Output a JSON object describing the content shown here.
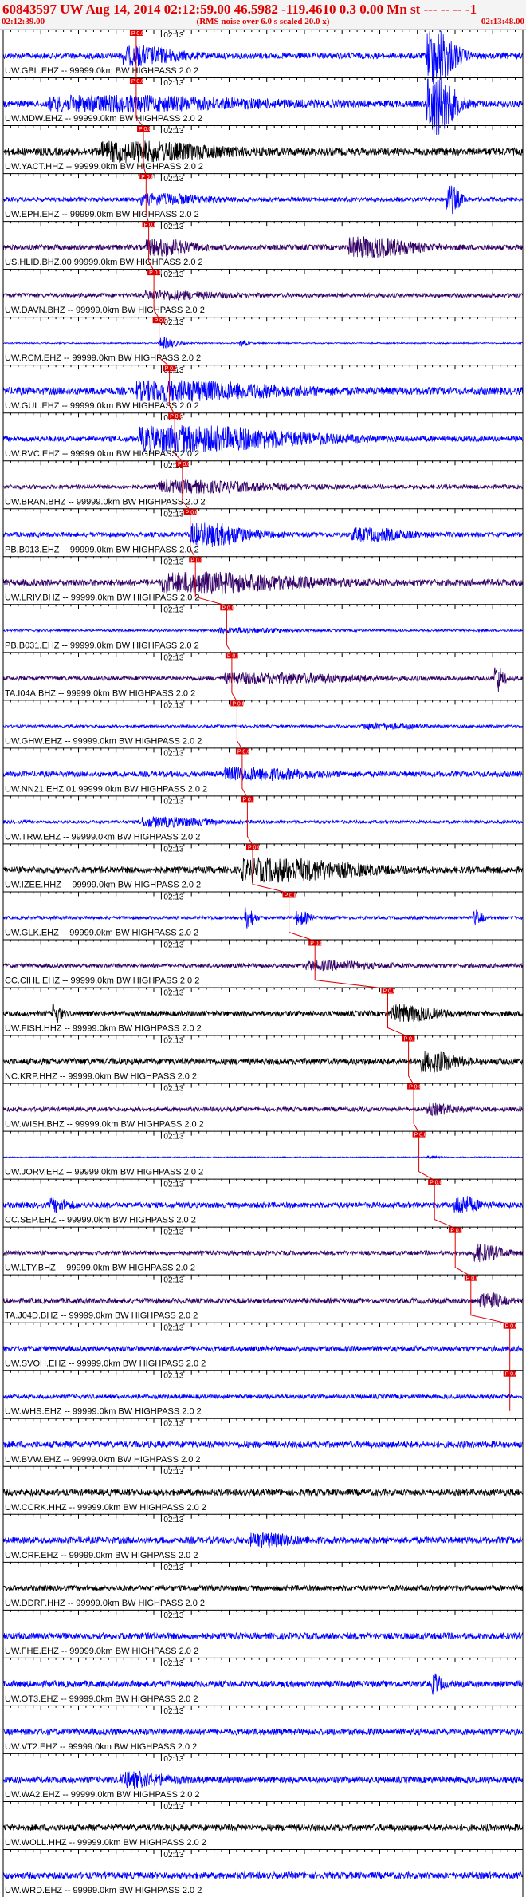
{
  "header": {
    "title": "60843597 UW Aug 14, 2014 02:12:59.00   46.5982 -119.4610  0.3 0.00 Mn st --- -- --  -1",
    "start_time": "02:12:39.00",
    "note": "(RMS noise over 6.0 s scaled 20.0 x)",
    "end_time": "02:13:48.00"
  },
  "minute_label": "02:13",
  "pick_marker_text": "P 0.0",
  "colors": {
    "title": "#e00000",
    "pick": "#e00000",
    "axis": "#000000"
  },
  "traces": [
    {
      "label": "UW.GBL.EHZ -- 99999.0km BW  HIGHPASS  2.0  2",
      "color": "#0000ff",
      "amp": 0.28,
      "pick": 0.256,
      "events": [
        [
          0.26,
          0.12,
          2.5
        ],
        [
          0.83,
          0.06,
          9
        ]
      ]
    },
    {
      "label": "UW.MDW.EHZ -- 99999.0km BW  HIGHPASS  2.0  2",
      "color": "#0000ff",
      "amp": 0.3,
      "pick": 0.256,
      "events": [
        [
          0.2,
          0.45,
          1.8
        ],
        [
          0.83,
          0.06,
          9
        ]
      ]
    },
    {
      "label": "UW.YACT.HHZ -- 99999.0km BW  HIGHPASS  2.0  2",
      "color": "#000000",
      "amp": 0.35,
      "pick": 0.27,
      "events": [
        [
          0.25,
          0.25,
          2.0
        ]
      ]
    },
    {
      "label": "UW.EPH.EHZ -- 99999.0km BW  HIGHPASS  2.0  2",
      "color": "#0000ff",
      "amp": 0.2,
      "pick": 0.275,
      "events": [
        [
          0.3,
          0.14,
          2.0
        ],
        [
          0.86,
          0.03,
          6
        ]
      ]
    },
    {
      "label": "US.HLID.BHZ.00 99999.0km BW  HIGHPASS  2.0  2",
      "color": "#330066",
      "amp": 0.25,
      "pick": 0.28,
      "events": [
        [
          0.3,
          0.1,
          2.5
        ],
        [
          0.7,
          0.14,
          3.2
        ]
      ]
    },
    {
      "label": "UW.DAVN.BHZ -- 99999.0km BW  HIGHPASS  2.0  2",
      "color": "#330066",
      "amp": 0.2,
      "pick": 0.29,
      "events": [
        [
          0.31,
          0.15,
          1.5
        ]
      ]
    },
    {
      "label": "UW.RCM.EHZ -- 99999.0km BW  HIGHPASS  2.0  2",
      "color": "#0000ff",
      "amp": 0.06,
      "pick": 0.3,
      "events": [
        [
          0.31,
          0.04,
          8
        ],
        [
          0.46,
          0.02,
          4
        ]
      ]
    },
    {
      "label": "UW.GUL.EHZ -- 99999.0km BW  HIGHPASS  2.0  2",
      "color": "#0000ff",
      "amp": 0.35,
      "pick": 0.32,
      "events": [
        [
          0.33,
          0.3,
          2.0
        ]
      ]
    },
    {
      "label": "UW.RVC.EHZ -- 99999.0km BW  HIGHPASS  2.0  2",
      "color": "#0000ff",
      "amp": 0.25,
      "pick": 0.33,
      "events": [
        [
          0.35,
          0.35,
          4.2
        ]
      ]
    },
    {
      "label": "UW.BRAN.BHZ -- 99999.0km BW  HIGHPASS  2.0  2",
      "color": "#330066",
      "amp": 0.2,
      "pick": 0.345,
      "events": [
        [
          0.36,
          0.25,
          2.2
        ]
      ]
    },
    {
      "label": "PB.B013.EHZ -- 99999.0km BW  HIGHPASS  2.0  2",
      "color": "#0000ff",
      "amp": 0.22,
      "pick": 0.36,
      "events": [
        [
          0.39,
          0.12,
          4.5
        ],
        [
          0.7,
          0.12,
          2.2
        ]
      ]
    },
    {
      "label": "UW.LRIV.BHZ -- 99999.0km BW  HIGHPASS  2.0  2",
      "color": "#330066",
      "amp": 0.3,
      "pick": 0.37,
      "events": [
        [
          0.38,
          0.3,
          2.5
        ]
      ]
    },
    {
      "label": "PB.B031.EHZ -- 99999.0km BW  HIGHPASS  2.0  2",
      "color": "#0000ff",
      "amp": 0.1,
      "pick": 0.43,
      "events": [
        [
          0.45,
          0.15,
          2.0
        ]
      ]
    },
    {
      "label": "TA.I04A.BHZ -- 99999.0km BW  HIGHPASS  2.0  2",
      "color": "#330066",
      "amp": 0.2,
      "pick": 0.44,
      "events": [
        [
          0.5,
          0.3,
          1.8
        ],
        [
          0.95,
          0.02,
          6
        ]
      ]
    },
    {
      "label": "UW.GHW.EHZ -- 99999.0km BW  HIGHPASS  2.0  2",
      "color": "#0000ff",
      "amp": 0.12,
      "pick": 0.45,
      "events": [
        [
          0.72,
          0.12,
          2.0
        ]
      ]
    },
    {
      "label": "UW.NN21.EHZ.01 99999.0km BW  HIGHPASS  2.0  2",
      "color": "#0000ff",
      "amp": 0.25,
      "pick": 0.46,
      "events": [
        [
          0.47,
          0.18,
          1.8
        ]
      ]
    },
    {
      "label": "UW.TRW.EHZ -- 99999.0km BW  HIGHPASS  2.0  2",
      "color": "#0000ff",
      "amp": 0.15,
      "pick": 0.47,
      "events": [
        [
          0.3,
          0.15,
          2.5
        ]
      ]
    },
    {
      "label": "UW.IZEE.HHZ -- 99999.0km BW  HIGHPASS  2.0  2",
      "color": "#000000",
      "amp": 0.3,
      "pick": 0.48,
      "events": [
        [
          0.52,
          0.25,
          3.0
        ]
      ]
    },
    {
      "label": "UW.GLK.EHZ -- 99999.0km BW  HIGHPASS  2.0  2",
      "color": "#0000ff",
      "amp": 0.15,
      "pick": 0.55,
      "events": [
        [
          0.47,
          0.02,
          6
        ],
        [
          0.57,
          0.03,
          4
        ],
        [
          0.91,
          0.02,
          4
        ]
      ]
    },
    {
      "label": "CC.CIHL.EHZ -- 99999.0km BW  HIGHPASS  2.0  2",
      "color": "#330066",
      "amp": 0.2,
      "pick": 0.6,
      "events": [
        [
          0.62,
          0.15,
          1.5
        ]
      ]
    },
    {
      "label": "UW.FISH.HHZ -- 99999.0km BW  HIGHPASS  2.0  2",
      "color": "#000000",
      "amp": 0.25,
      "pick": 0.74,
      "events": [
        [
          0.77,
          0.1,
          2.5
        ],
        [
          0.1,
          0.02,
          3
        ]
      ]
    },
    {
      "label": "NC.KRP.HHZ -- 99999.0km BW  HIGHPASS  2.0  2",
      "color": "#000000",
      "amp": 0.3,
      "pick": 0.78,
      "events": [
        [
          0.82,
          0.08,
          2.5
        ]
      ]
    },
    {
      "label": "UW.WISH.BHZ -- 99999.0km BW  HIGHPASS  2.0  2",
      "color": "#330066",
      "amp": 0.2,
      "pick": 0.79,
      "events": [
        [
          0.83,
          0.06,
          2.0
        ]
      ]
    },
    {
      "label": "UW.JORV.EHZ -- 99999.0km BW  HIGHPASS  2.0  2",
      "color": "#0000ff",
      "amp": 0.05,
      "pick": 0.8,
      "events": [
        [
          0.82,
          0.03,
          2.0
        ]
      ]
    },
    {
      "label": "CC.SEP.EHZ -- 99999.0km BW  HIGHPASS  2.0  2",
      "color": "#0000ff",
      "amp": 0.25,
      "pick": 0.83,
      "events": [
        [
          0.88,
          0.05,
          3.0
        ],
        [
          0.1,
          0.04,
          2.0
        ]
      ]
    },
    {
      "label": "UW.LTY.BHZ -- 99999.0km BW  HIGHPASS  2.0  2",
      "color": "#330066",
      "amp": 0.2,
      "pick": 0.87,
      "events": [
        [
          0.92,
          0.06,
          3.5
        ]
      ]
    },
    {
      "label": "TA.J04D.BHZ -- 99999.0km BW  HIGHPASS  2.0  2",
      "color": "#330066",
      "amp": 0.25,
      "pick": 0.9,
      "events": [
        [
          0.93,
          0.05,
          2.5
        ]
      ]
    },
    {
      "label": "UW.SVOH.EHZ -- 99999.0km BW  HIGHPASS  2.0  2",
      "color": "#0000ff",
      "amp": 0.25,
      "pick": 0.975,
      "events": []
    },
    {
      "label": "UW.WHS.EHZ -- 99999.0km BW  HIGHPASS  2.0  2",
      "color": "#0000ff",
      "amp": 0.2,
      "pick": 0.975,
      "events": []
    },
    {
      "label": "UW.BVW.EHZ -- 99999.0km BW  HIGHPASS  2.0  2",
      "color": "#0000ff",
      "amp": 0.3,
      "events": []
    },
    {
      "label": "UW.CCRK.HHZ -- 99999.0km BW  HIGHPASS  2.0  2",
      "color": "#000000",
      "amp": 0.3,
      "events": []
    },
    {
      "label": "UW.CRF.EHZ -- 99999.0km BW  HIGHPASS  2.0  2",
      "color": "#0000ff",
      "amp": 0.3,
      "events": [
        [
          0.5,
          0.1,
          1.5
        ]
      ]
    },
    {
      "label": "UW.DDRF.HHZ -- 99999.0km BW  HIGHPASS  2.0  2",
      "color": "#000000",
      "amp": 0.25,
      "events": []
    },
    {
      "label": "UW.FHE.EHZ -- 99999.0km BW  HIGHPASS  2.0  2",
      "color": "#0000ff",
      "amp": 0.3,
      "events": []
    },
    {
      "label": "UW.OT3.EHZ -- 99999.0km BW  HIGHPASS  2.0  2",
      "color": "#0000ff",
      "amp": 0.3,
      "events": [
        [
          0.83,
          0.02,
          2.5
        ]
      ]
    },
    {
      "label": "UW.VT2.EHZ -- 99999.0km BW  HIGHPASS  2.0  2",
      "color": "#0000ff",
      "amp": 0.3,
      "events": []
    },
    {
      "label": "UW.WA2.EHZ -- 99999.0km BW  HIGHPASS  2.0  2",
      "color": "#0000ff",
      "amp": 0.3,
      "events": [
        [
          0.25,
          0.1,
          1.8
        ]
      ]
    },
    {
      "label": "UW.WOLL.HHZ -- 99999.0km BW  HIGHPASS  2.0  2",
      "color": "#000000",
      "amp": 0.3,
      "events": []
    },
    {
      "label": "UW.WRD.EHZ -- 99999.0km BW  HIGHPASS  2.0  2",
      "color": "#0000ff",
      "amp": 0.3,
      "events": []
    }
  ]
}
